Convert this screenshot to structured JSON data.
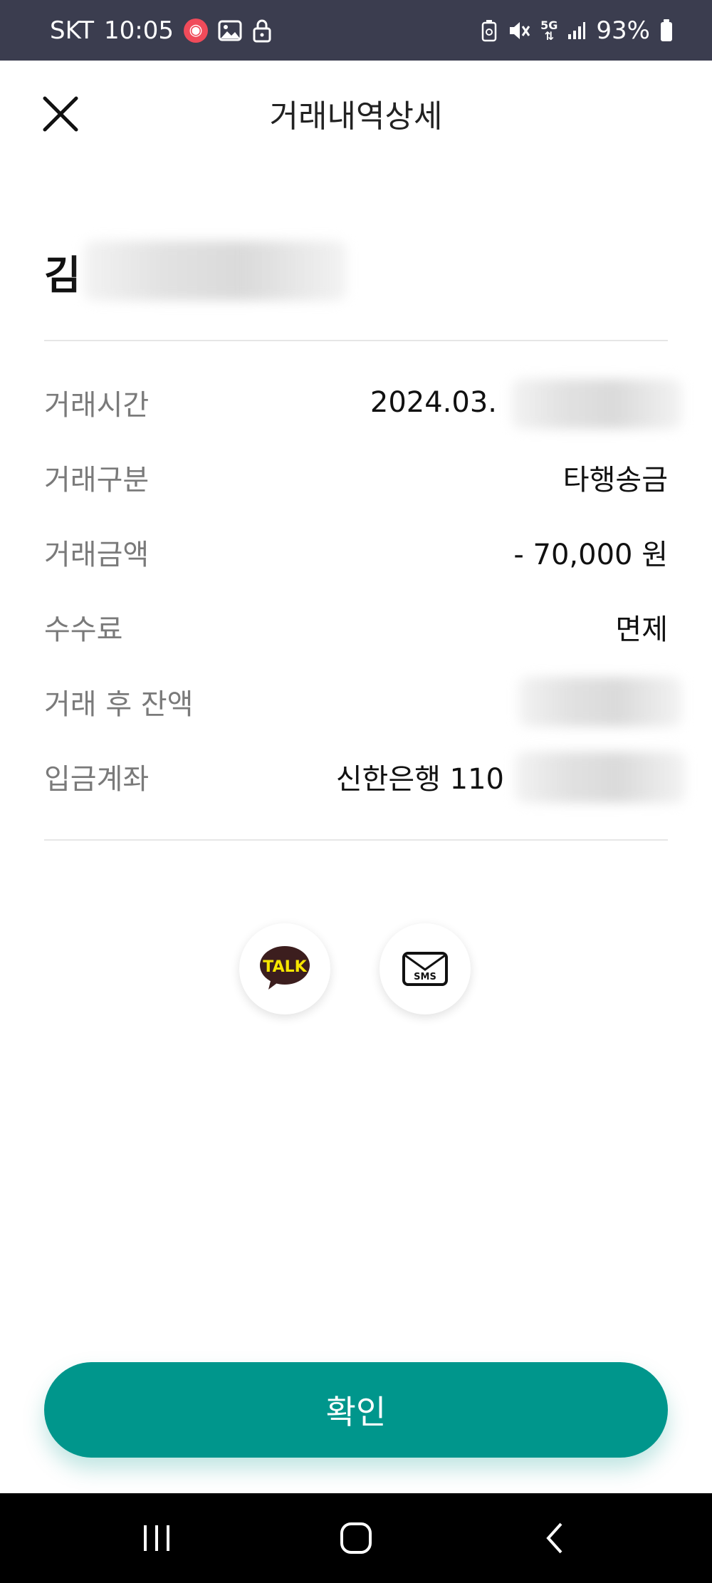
{
  "status_bar": {
    "carrier": "SKT",
    "time": "10:05",
    "network": "5G",
    "battery": "93%"
  },
  "header": {
    "title": "거래내역상세"
  },
  "recipient": {
    "name_visible": "김"
  },
  "details": [
    {
      "label": "거래시간",
      "value": "2024.03."
    },
    {
      "label": "거래구분",
      "value": "타행송금"
    },
    {
      "label": "거래금액",
      "value": "- 70,000 원"
    },
    {
      "label": "수수료",
      "value": "면제"
    },
    {
      "label": "거래 후 잔액",
      "value": ""
    },
    {
      "label": "입금계좌",
      "value": "신한은행 110"
    }
  ],
  "share": {
    "talk_label": "TALK",
    "sms_label": "SMS"
  },
  "confirm": {
    "label": "확인"
  },
  "colors": {
    "accent": "#00968c",
    "status_bar": "#3b3d4f",
    "talk_bubble": "#3c1e1e",
    "talk_text": "#f7e600"
  }
}
